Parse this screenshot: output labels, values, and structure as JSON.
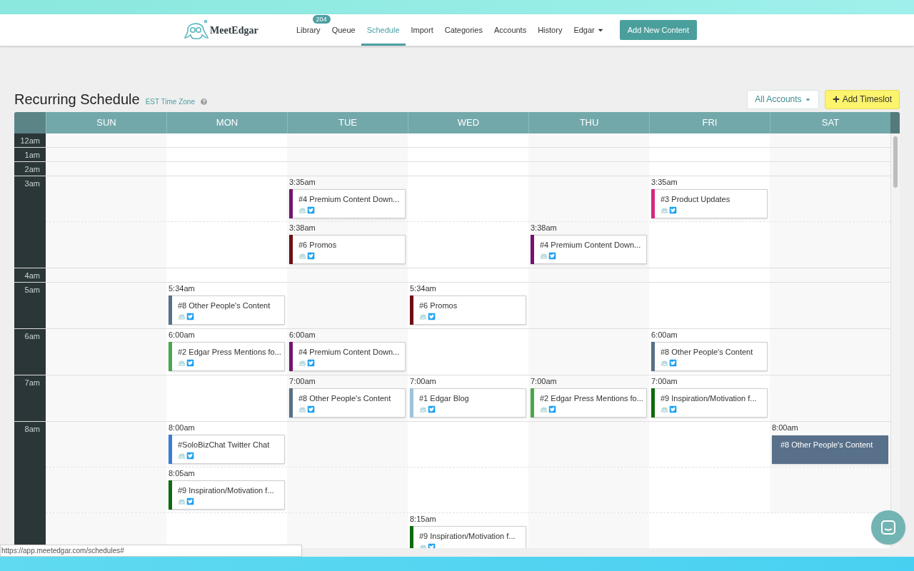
{
  "nav": {
    "logo": "MeetEdgar",
    "items": [
      {
        "label": "Library",
        "badge": "204",
        "selected": false,
        "kind": "link"
      },
      {
        "label": "Queue",
        "selected": false,
        "kind": "link"
      },
      {
        "label": "Schedule",
        "selected": true,
        "kind": "link"
      },
      {
        "label": "Import",
        "selected": false,
        "kind": "link"
      },
      {
        "label": "Categories",
        "selected": false,
        "kind": "link"
      },
      {
        "label": "Accounts",
        "selected": false,
        "kind": "link"
      },
      {
        "label": "History",
        "selected": false,
        "kind": "link"
      },
      {
        "label": "Edgar",
        "selected": false,
        "kind": "dropdown"
      }
    ],
    "cta": "Add New Content"
  },
  "page": {
    "title": "Recurring Schedule",
    "timezone": "EST Time Zone",
    "account_filter": "All Accounts",
    "add_button": "Add Timeslot"
  },
  "days": [
    "SUN",
    "MON",
    "TUE",
    "WED",
    "THU",
    "FRI",
    "SAT"
  ],
  "hours": [
    {
      "label": "12am"
    },
    {
      "label": "1am"
    },
    {
      "label": "2am"
    },
    {
      "label": "3am",
      "slots": [
        {
          "cells": [
            {},
            {},
            {
              "time": "3:35am",
              "title": "#4 Premium Content Down...",
              "color": "#74136f",
              "selected": false
            },
            {},
            {},
            {
              "time": "3:35am",
              "title": "#3 Product Updates",
              "color": "#d6297f",
              "selected": false
            },
            {}
          ]
        },
        {
          "cells": [
            {},
            {},
            {
              "time": "3:38am",
              "title": "#6 Promos",
              "color": "#6e0f12",
              "selected": false
            },
            {},
            {
              "time": "3:38am",
              "title": "#4 Premium Content Down...",
              "color": "#74136f",
              "selected": false
            },
            {},
            {}
          ]
        }
      ]
    },
    {
      "label": "4am"
    },
    {
      "label": "5am",
      "slots": [
        {
          "cells": [
            {},
            {
              "time": "5:34am",
              "title": "#8 Other People's Content",
              "color": "#587089",
              "selected": false
            },
            {},
            {
              "time": "5:34am",
              "title": "#6 Promos",
              "color": "#6e0f12",
              "selected": false
            },
            {},
            {},
            {}
          ]
        }
      ]
    },
    {
      "label": "6am",
      "slots": [
        {
          "cells": [
            {},
            {
              "time": "6:00am",
              "title": "#2 Edgar Press Mentions fo...",
              "color": "#4aa84a",
              "selected": false
            },
            {
              "time": "6:00am",
              "title": "#4 Premium Content Down...",
              "color": "#74136f",
              "selected": false
            },
            {},
            {},
            {
              "time": "6:00am",
              "title": "#8 Other People's Content",
              "color": "#587089",
              "selected": false
            },
            {}
          ]
        }
      ]
    },
    {
      "label": "7am",
      "slots": [
        {
          "cells": [
            {},
            {},
            {
              "time": "7:00am",
              "title": "#8 Other People's Content",
              "color": "#587089",
              "selected": false
            },
            {
              "time": "7:00am",
              "title": "#1 Edgar Blog",
              "color": "#9ec3d6",
              "selected": false
            },
            {
              "time": "7:00am",
              "title": "#2 Edgar Press Mentions fo...",
              "color": "#4aa84a",
              "selected": false
            },
            {
              "time": "7:00am",
              "title": "#9 Inspiration/Motivation f...",
              "color": "#0e6b0e",
              "selected": false
            },
            {}
          ]
        }
      ]
    },
    {
      "label": "8am",
      "slots": [
        {
          "cells": [
            {},
            {
              "time": "8:00am",
              "title": "#SoloBizChat Twitter Chat",
              "color": "#3a7bd5",
              "selected": false
            },
            {},
            {},
            {},
            {},
            {
              "time": "8:00am",
              "title": "#8 Other People's Content",
              "color": "#587089",
              "selected": true
            }
          ]
        },
        {
          "cells": [
            {},
            {
              "time": "8:05am",
              "title": "#9 Inspiration/Motivation f...",
              "color": "#0e6b0e",
              "selected": false
            },
            {},
            {},
            {},
            {},
            {}
          ]
        },
        {
          "cells": [
            {},
            {},
            {},
            {
              "time": "8:15am",
              "title": "#9 Inspiration/Motivation f...",
              "color": "#0e6b0e",
              "selected": false
            },
            {},
            {},
            {}
          ]
        }
      ]
    }
  ],
  "status_url": "https://app.meetedgar.com/schedules#"
}
